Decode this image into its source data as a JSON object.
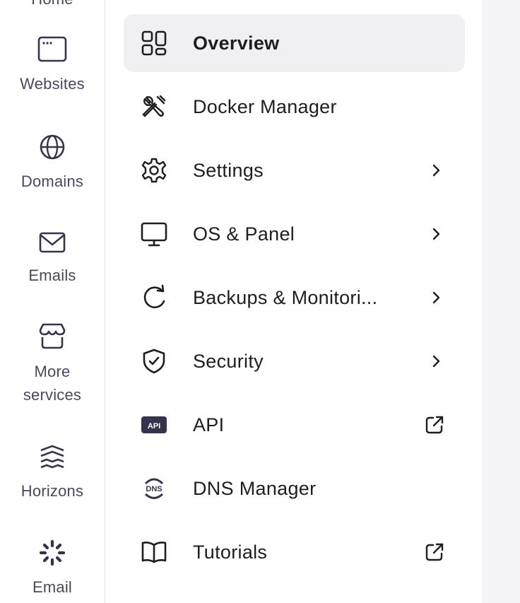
{
  "rail": {
    "items": [
      {
        "label": "Home",
        "icon": "home-icon"
      },
      {
        "label": "Websites",
        "icon": "browser-window-icon"
      },
      {
        "label": "Domains",
        "icon": "globe-icon"
      },
      {
        "label": "Emails",
        "icon": "envelope-icon"
      },
      {
        "label": "More\nservices",
        "label_line1": "More",
        "label_line2": "services",
        "icon": "storefront-icon"
      },
      {
        "label": "Horizons",
        "icon": "horizons-icon"
      },
      {
        "label": "Email",
        "icon": "loading-spinner-icon"
      }
    ]
  },
  "menu": {
    "items": [
      {
        "label": "Overview",
        "icon": "grid-overview-icon",
        "active": true
      },
      {
        "label": "Docker Manager",
        "icon": "tools-icon"
      },
      {
        "label": "Settings",
        "icon": "gear-icon",
        "trailing": "chevron-right-icon"
      },
      {
        "label": "OS & Panel",
        "icon": "monitor-icon",
        "trailing": "chevron-right-icon"
      },
      {
        "label": "Backups & Monitori...",
        "icon": "refresh-icon",
        "trailing": "chevron-right-icon"
      },
      {
        "label": "Security",
        "icon": "shield-check-icon",
        "trailing": "chevron-right-icon"
      },
      {
        "label": "API",
        "icon": "api-badge-icon",
        "icon_text": "API",
        "trailing": "external-link-icon"
      },
      {
        "label": "DNS Manager",
        "icon": "dns-globe-icon",
        "icon_text": "DNS"
      },
      {
        "label": "Tutorials",
        "icon": "book-icon",
        "trailing": "external-link-icon"
      }
    ]
  },
  "colors": {
    "text": "#1d1e20",
    "rail_text": "#4a4860",
    "active_bg": "#f0f0f2",
    "divider": "#e4e4e8"
  }
}
